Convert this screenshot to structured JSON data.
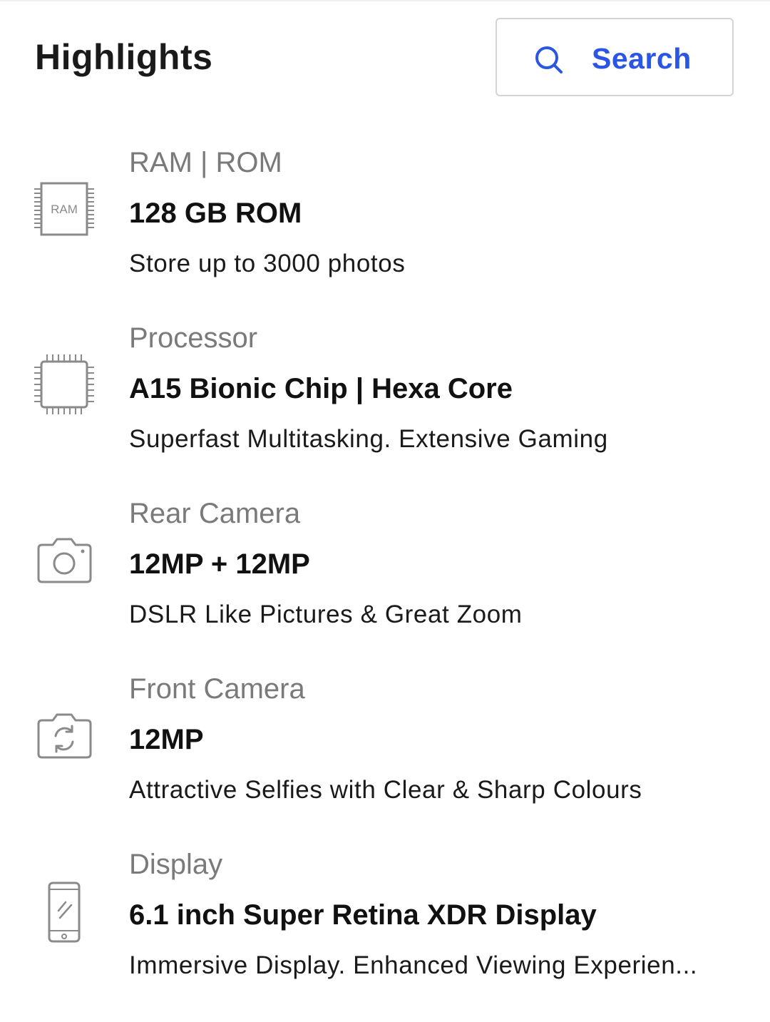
{
  "header": {
    "title": "Highlights",
    "search_label": "Search"
  },
  "colors": {
    "accent": "#2a55e5",
    "category_text": "#7a7a7a",
    "icon_stroke": "#8a8a8a"
  },
  "highlights": [
    {
      "icon": "ram-chip-icon",
      "icon_text": "RAM",
      "category": "RAM | ROM",
      "value": "128 GB ROM",
      "description": "Store up to 3000 photos"
    },
    {
      "icon": "processor-chip-icon",
      "category": "Processor",
      "value": "A15 Bionic Chip | Hexa Core",
      "description": "Superfast Multitasking. Extensive Gaming"
    },
    {
      "icon": "rear-camera-icon",
      "category": "Rear Camera",
      "value": "12MP + 12MP",
      "description": "DSLR Like Pictures & Great Zoom"
    },
    {
      "icon": "front-camera-icon",
      "category": "Front Camera",
      "value": "12MP",
      "description": "Attractive Selfies with Clear & Sharp Colours"
    },
    {
      "icon": "phone-display-icon",
      "category": "Display",
      "value": "6.1 inch Super Retina XDR Display",
      "description": "Immersive Display. Enhanced Viewing Experien..."
    }
  ]
}
